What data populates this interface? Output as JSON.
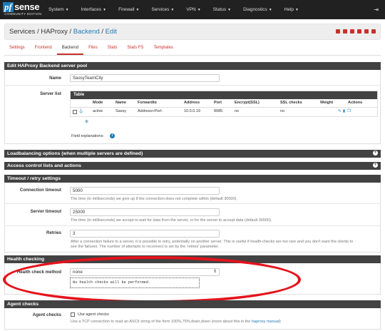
{
  "brand": {
    "logo_pf": "pf",
    "logo_sense": "sense",
    "logo_sub": "COMMUNITY EDITION"
  },
  "nav": {
    "items": [
      "System",
      "Interfaces",
      "Firewall",
      "Services",
      "VPN",
      "Status",
      "Diagnostics",
      "Help"
    ],
    "logout_icon": "logout-icon"
  },
  "breadcrumb": {
    "services": "Services",
    "haproxy": "HAProxy",
    "backend": "Backend",
    "edit": "Edit",
    "sep": "/"
  },
  "tabs": [
    "Settings",
    "Frontend",
    "Backend",
    "Files",
    "Stats",
    "Stats FS",
    "Templates"
  ],
  "active_tab": "Backend",
  "panels": {
    "edit_title": "Edit HAProxy Backend server pool",
    "loadbalancing_title": "Loadbalancing options (when multiple servers are defined)",
    "acl_title": "Access control lists and actions",
    "timeout_title": "Timeout / retry settings",
    "health_title": "Health checking",
    "agent_title": "Agent checks"
  },
  "form": {
    "name_label": "Name",
    "name_value": "SassyTeamCity",
    "serverlist_label": "Server list",
    "field_explanations": "Field explanations:",
    "conn_timeout_label": "Connection timeout",
    "conn_timeout_value": "5000",
    "conn_timeout_help": "The time (in milliseconds) we give up if the connection does not complete within (default 30000).",
    "server_timeout_label": "Server timeout",
    "server_timeout_value": "25000",
    "server_timeout_help": "The time (in milliseconds) we accept to wait for data from the server, or for the server to accept data (default 30000).",
    "retries_label": "Retries",
    "retries_value": "3",
    "retries_help1": "After a connection failure to a server, it is possible to retry, potentially on another server. This is useful if health-checks are too rare and you don't want the clients to",
    "retries_help2": "see the failures. The number of attempts to reconnect is set by the 'retries' parameter.",
    "health_method_label": "Health check method",
    "health_method_value": "none",
    "health_desc": "No health checks will be performed.",
    "agent_label": "Agent checks",
    "agent_checkbox": "Use agent checks",
    "agent_help_prefix": "Use a TCP connection to read an ASCII string of the form 100%,75%,drain,down (more about this in the",
    "agent_help_link": "haproxy manual",
    "agent_help_suffix": ")"
  },
  "server_table": {
    "title": "Table",
    "headers": [
      "Mode",
      "Name",
      "Forwardto",
      "Address",
      "Port",
      "Encrypt(SSL)",
      "SSL checks",
      "Weight",
      "Actions"
    ],
    "row": {
      "mode": "active",
      "name": "Sassy",
      "forwardto": "Address+Port:",
      "address": "10.0.0.19",
      "port": "8085",
      "encrypt": "no",
      "ssl_checks": "no",
      "weight": ""
    }
  },
  "colors": {
    "navbar": "#212121",
    "panel_head": "#424242",
    "accent_red": "#c9302c",
    "link_blue": "#1e7ab8",
    "annotation_red": "#e5121b"
  }
}
